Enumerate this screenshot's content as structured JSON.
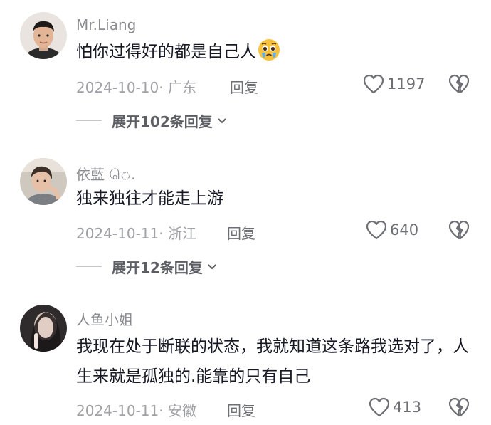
{
  "comments": [
    {
      "username": "Mr.Liang",
      "text": "怕你过得好的都是自己人",
      "emoji": "pleading-crying-face",
      "date": "2024-10-10",
      "location": "· 广东",
      "reply_label": "回复",
      "likes": "1197",
      "expand_label": "展开102条回复"
    },
    {
      "username": "依藍 ெ.",
      "text": "独来独往才能走上游",
      "date": "2024-10-11",
      "location": "· 浙江",
      "reply_label": "回复",
      "likes": "640",
      "expand_label": "展开12条回复"
    },
    {
      "username": "人鱼小姐",
      "text": "我现在处于断联的状态，我就知道这条路我选对了，人生来就是孤独的.能靠的只有自己",
      "date": "2024-10-11",
      "location": "· 安徽",
      "reply_label": "回复",
      "likes": "413"
    }
  ],
  "colors": {
    "username": "#8a8b91",
    "text": "#161823",
    "meta": "#a0a1a6"
  }
}
